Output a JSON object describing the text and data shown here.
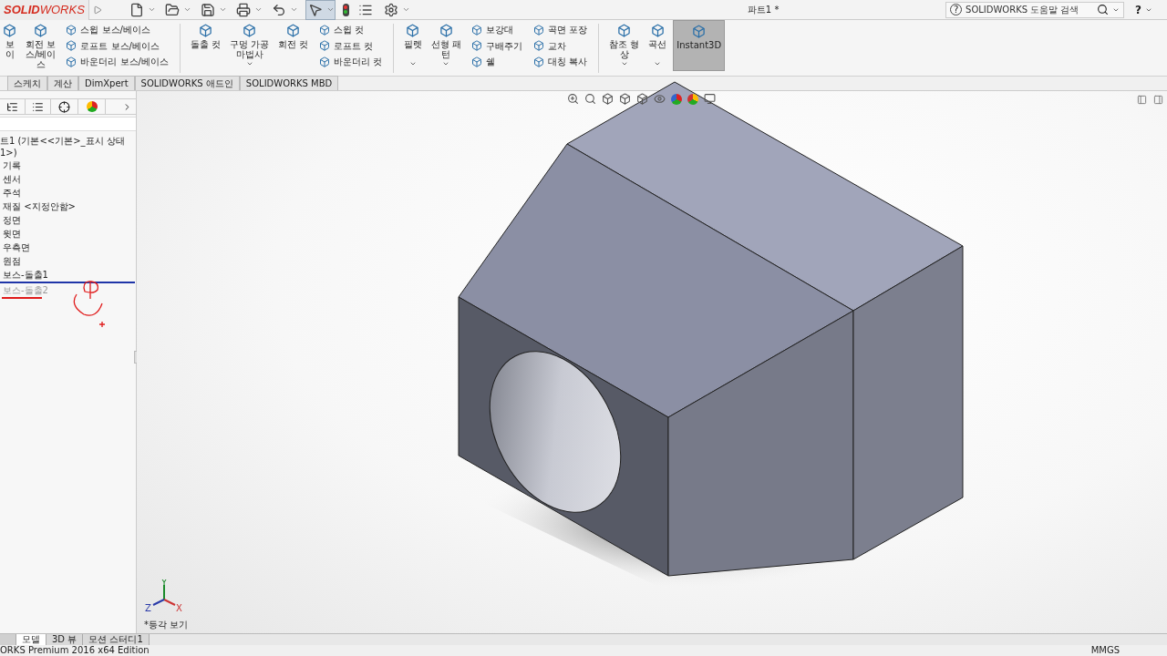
{
  "title_bar": {
    "logo": "**SOLID**WORKS",
    "document_title": "파트1 *",
    "search": {
      "icon": "?",
      "placeholder": "SOLIDWORKS 도움말 검색"
    },
    "help": "?"
  },
  "ribbon": {
    "groups": [
      {
        "kind": "big",
        "lines": [
          "보",
          "이"
        ],
        "dropdown": false,
        "selected": false
      },
      {
        "kind": "big",
        "lines": [
          "회전 보",
          "스/베이",
          "스"
        ],
        "dropdown": false,
        "selected": false
      },
      {
        "kind": "small",
        "items": [
          "스윕 보스/베이스",
          "로프트 보스/베이스",
          "바운더리 보스/베이스"
        ]
      },
      {
        "kind": "separator"
      },
      {
        "kind": "big",
        "lines": [
          "돌출 컷"
        ],
        "dropdown": false,
        "selected": false
      },
      {
        "kind": "big",
        "lines": [
          "구멍 가공",
          "마법사"
        ],
        "dropdown": true,
        "selected": false
      },
      {
        "kind": "big",
        "lines": [
          "회전 컷"
        ],
        "dropdown": false,
        "selected": false
      },
      {
        "kind": "small",
        "items": [
          "스윕 컷",
          "로프트 컷",
          "바운더리 컷"
        ]
      },
      {
        "kind": "separator"
      },
      {
        "kind": "big",
        "lines": [
          "필렛"
        ],
        "dropdown": true,
        "selected": false
      },
      {
        "kind": "big",
        "lines": [
          "선형 패",
          "턴"
        ],
        "dropdown": true,
        "selected": false
      },
      {
        "kind": "small",
        "items": [
          "보강대",
          "구배주기",
          "쉘"
        ]
      },
      {
        "kind": "small",
        "items": [
          "곡면 포장",
          "교차",
          "대칭 복사"
        ]
      },
      {
        "kind": "separator"
      },
      {
        "kind": "big",
        "lines": [
          "참조 형",
          "상"
        ],
        "dropdown": true,
        "selected": false
      },
      {
        "kind": "big",
        "lines": [
          "곡선"
        ],
        "dropdown": true,
        "selected": false
      },
      {
        "kind": "big",
        "lines": [
          "Instant3D"
        ],
        "dropdown": false,
        "selected": true
      }
    ]
  },
  "command_tabs": [
    "스케치",
    "계산",
    "DimXpert",
    "SOLIDWORKS 애드인",
    "SOLIDWORKS MBD"
  ],
  "feature_tree": {
    "root": "트1 (기본<<기본>_표시 상태 1>)",
    "items": [
      {
        "label": "기록",
        "disabled": false
      },
      {
        "label": "센서",
        "disabled": false
      },
      {
        "label": "주석",
        "disabled": false
      },
      {
        "label": "재질 <지정안함>",
        "disabled": false
      },
      {
        "label": "정면",
        "disabled": false
      },
      {
        "label": "윗면",
        "disabled": false
      },
      {
        "label": "우측면",
        "disabled": false
      },
      {
        "label": "원점",
        "disabled": false
      },
      {
        "label": "보스-돌출1",
        "disabled": false
      },
      {
        "label": "보스-돌출2",
        "disabled": true
      }
    ]
  },
  "viewport": {
    "triad": {
      "x": "X",
      "y": "Y",
      "z": "Z"
    },
    "view_name": "*등각 보기"
  },
  "bottom_tabs": [
    {
      "label": "모델",
      "selected": true
    },
    {
      "label": "3D 뷰",
      "selected": false
    },
    {
      "label": "모션 스터디1",
      "selected": false
    }
  ],
  "status_bar": {
    "edition": "ORKS Premium 2016 x64 Edition",
    "units": "MMGS"
  }
}
